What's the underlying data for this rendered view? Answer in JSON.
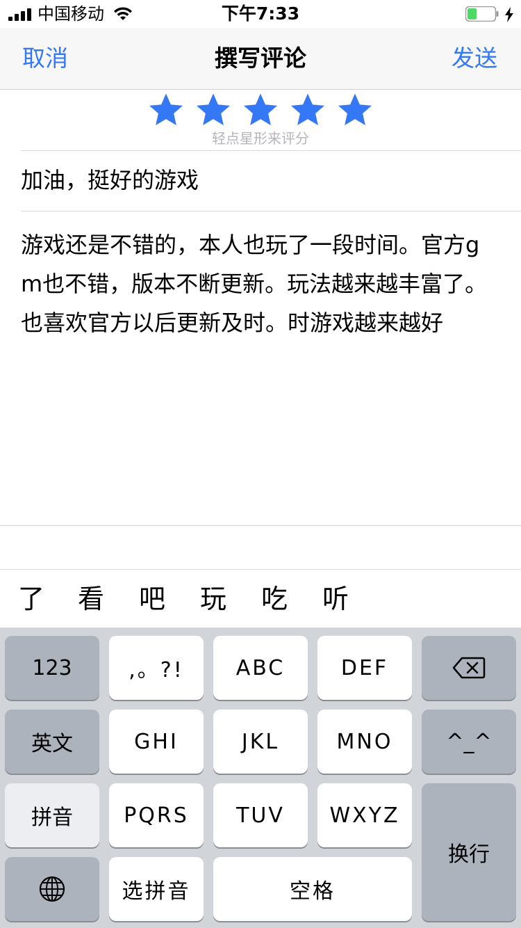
{
  "status_bar": {
    "carrier": "中国移动",
    "time": "下午7:33",
    "battery_level": 0.35,
    "battery_color": "#4cd964"
  },
  "nav": {
    "cancel": "取消",
    "title": "撰写评论",
    "send": "发送",
    "accent_color": "#3478f6"
  },
  "rating": {
    "stars_selected": 5,
    "stars_total": 5,
    "hint": "轻点星形来评分",
    "star_color": "#3478f6"
  },
  "review": {
    "title": "加油，挺好的游戏",
    "body": "游戏还是不错的，本人也玩了一段时间。官方gm也不错，版本不断更新。玩法越来越丰富了。也喜欢官方以后更新及时。时游戏越来越好"
  },
  "candidates": [
    "了",
    "看",
    "吧",
    "玩",
    "吃",
    "听"
  ],
  "keyboard": {
    "k123": "123",
    "punct": ",。?!",
    "abc": "ABC",
    "def": "DEF",
    "backspace_icon": "backspace-icon",
    "english": "英文",
    "ghi": "GHI",
    "jkl": "JKL",
    "mno": "MNO",
    "emoticon": "^_^",
    "pinyin": "拼音",
    "pqrs": "PQRS",
    "tuv": "TUV",
    "wxyz": "WXYZ",
    "return": "换行",
    "globe_icon": "globe-icon",
    "select_pinyin": "选拼音",
    "space": "空格"
  }
}
